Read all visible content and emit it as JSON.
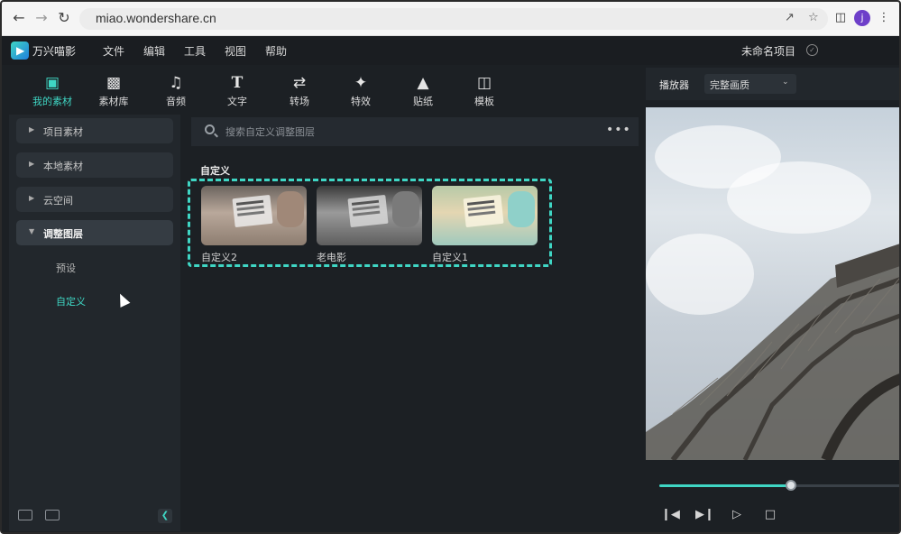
{
  "browser": {
    "url": "miao.wondershare.cn",
    "profile_initial": "j"
  },
  "app": {
    "name": "万兴喵影",
    "menu": [
      "文件",
      "编辑",
      "工具",
      "视图",
      "帮助"
    ],
    "project_name": "未命名项目"
  },
  "toolbar": {
    "tools": [
      {
        "label": "我的素材",
        "icon": "media-folder-icon",
        "active": true
      },
      {
        "label": "素材库",
        "icon": "stock-library-icon",
        "active": false
      },
      {
        "label": "音频",
        "icon": "music-note-icon",
        "active": false
      },
      {
        "label": "文字",
        "icon": "text-t-icon",
        "active": false
      },
      {
        "label": "转场",
        "icon": "transition-icon",
        "active": false
      },
      {
        "label": "特效",
        "icon": "effects-star-icon",
        "active": false
      },
      {
        "label": "贴纸",
        "icon": "sticker-icon",
        "active": false
      },
      {
        "label": "模板",
        "icon": "template-icon",
        "active": false
      }
    ]
  },
  "sidebar": {
    "items": [
      {
        "label": "项目素材"
      },
      {
        "label": "本地素材"
      },
      {
        "label": "云空间"
      },
      {
        "label": "调整图层"
      }
    ],
    "subitems": [
      {
        "label": "预设"
      },
      {
        "label": "自定义"
      }
    ]
  },
  "main": {
    "search_placeholder": "搜索自定义调整图层",
    "section_title": "自定义",
    "items": [
      {
        "label": "自定义2"
      },
      {
        "label": "老电影"
      },
      {
        "label": "自定义1"
      }
    ]
  },
  "player": {
    "title": "播放器",
    "quality": "完整画质",
    "progress": 0.55
  },
  "colors": {
    "accent": "#3fd6c4",
    "bg": "#1c2024",
    "panel": "#22272c"
  }
}
